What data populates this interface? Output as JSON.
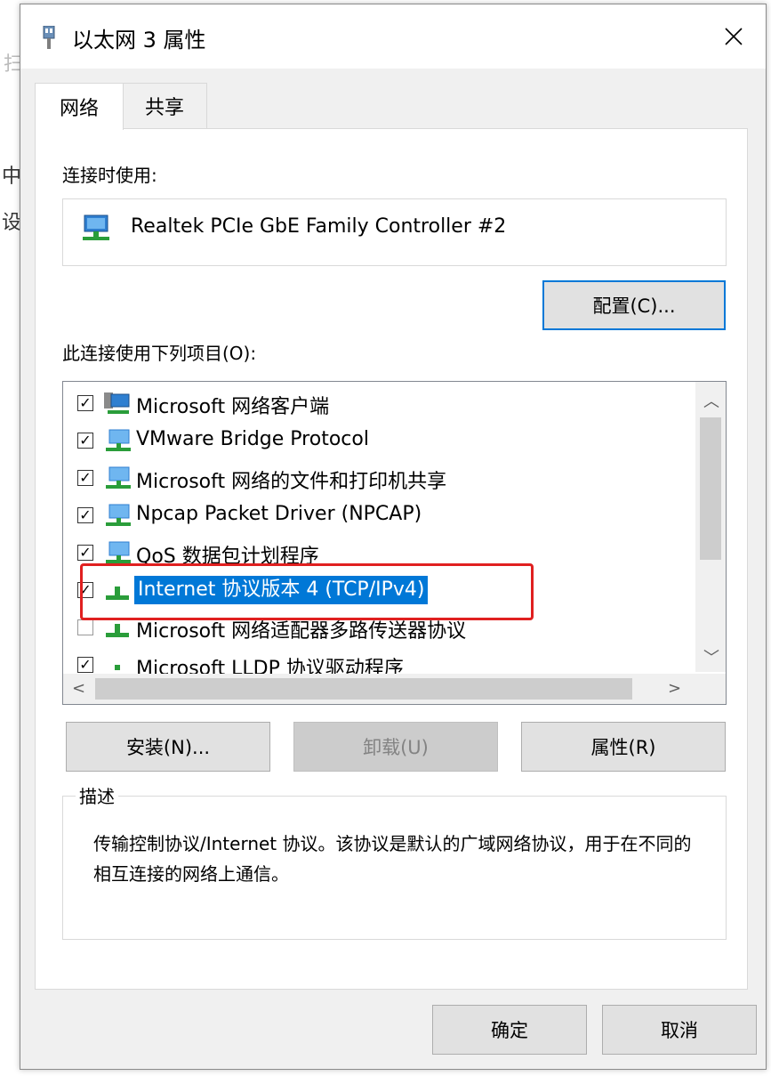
{
  "background_fragments": [
    "扫",
    "中",
    "设"
  ],
  "window": {
    "title": "以太网 3 属性",
    "close_icon": "close-icon"
  },
  "tabs": [
    {
      "label": "网络",
      "active": true
    },
    {
      "label": "共享",
      "active": false
    }
  ],
  "connect_using": {
    "label": "连接时使用:",
    "adapter_name": "Realtek PCIe GbE Family Controller #2",
    "configure_button": "配置(C)..."
  },
  "items_section": {
    "label": "此连接使用下列项目(O):",
    "items": [
      {
        "label": "Microsoft 网络客户端",
        "checked": true,
        "icon": "network-client-icon"
      },
      {
        "label": "VMware Bridge Protocol",
        "checked": true,
        "icon": "network-service-icon"
      },
      {
        "label": "Microsoft 网络的文件和打印机共享",
        "checked": true,
        "icon": "network-service-icon"
      },
      {
        "label": "Npcap Packet Driver (NPCAP)",
        "checked": true,
        "icon": "network-service-icon"
      },
      {
        "label": "QoS 数据包计划程序",
        "checked": true,
        "icon": "network-service-icon"
      },
      {
        "label": "Internet 协议版本 4 (TCP/IPv4)",
        "checked": true,
        "icon": "protocol-icon",
        "selected": true
      },
      {
        "label": "Microsoft 网络适配器多路传送器协议",
        "checked": false,
        "icon": "protocol-icon"
      },
      {
        "label": "Microsoft LLDP 协议驱动程序",
        "checked": true,
        "icon": "protocol-icon"
      }
    ]
  },
  "buttons": {
    "install": "安装(N)...",
    "uninstall": "卸载(U)",
    "properties": "属性(R)",
    "ok": "确定",
    "cancel": "取消"
  },
  "description": {
    "legend": "描述",
    "text": "传输控制协议/Internet 协议。该协议是默认的广域网络协议，用于在不同的相互连接的网络上通信。"
  },
  "colors": {
    "selection": "#0078d7",
    "highlight_box": "#e02020"
  }
}
